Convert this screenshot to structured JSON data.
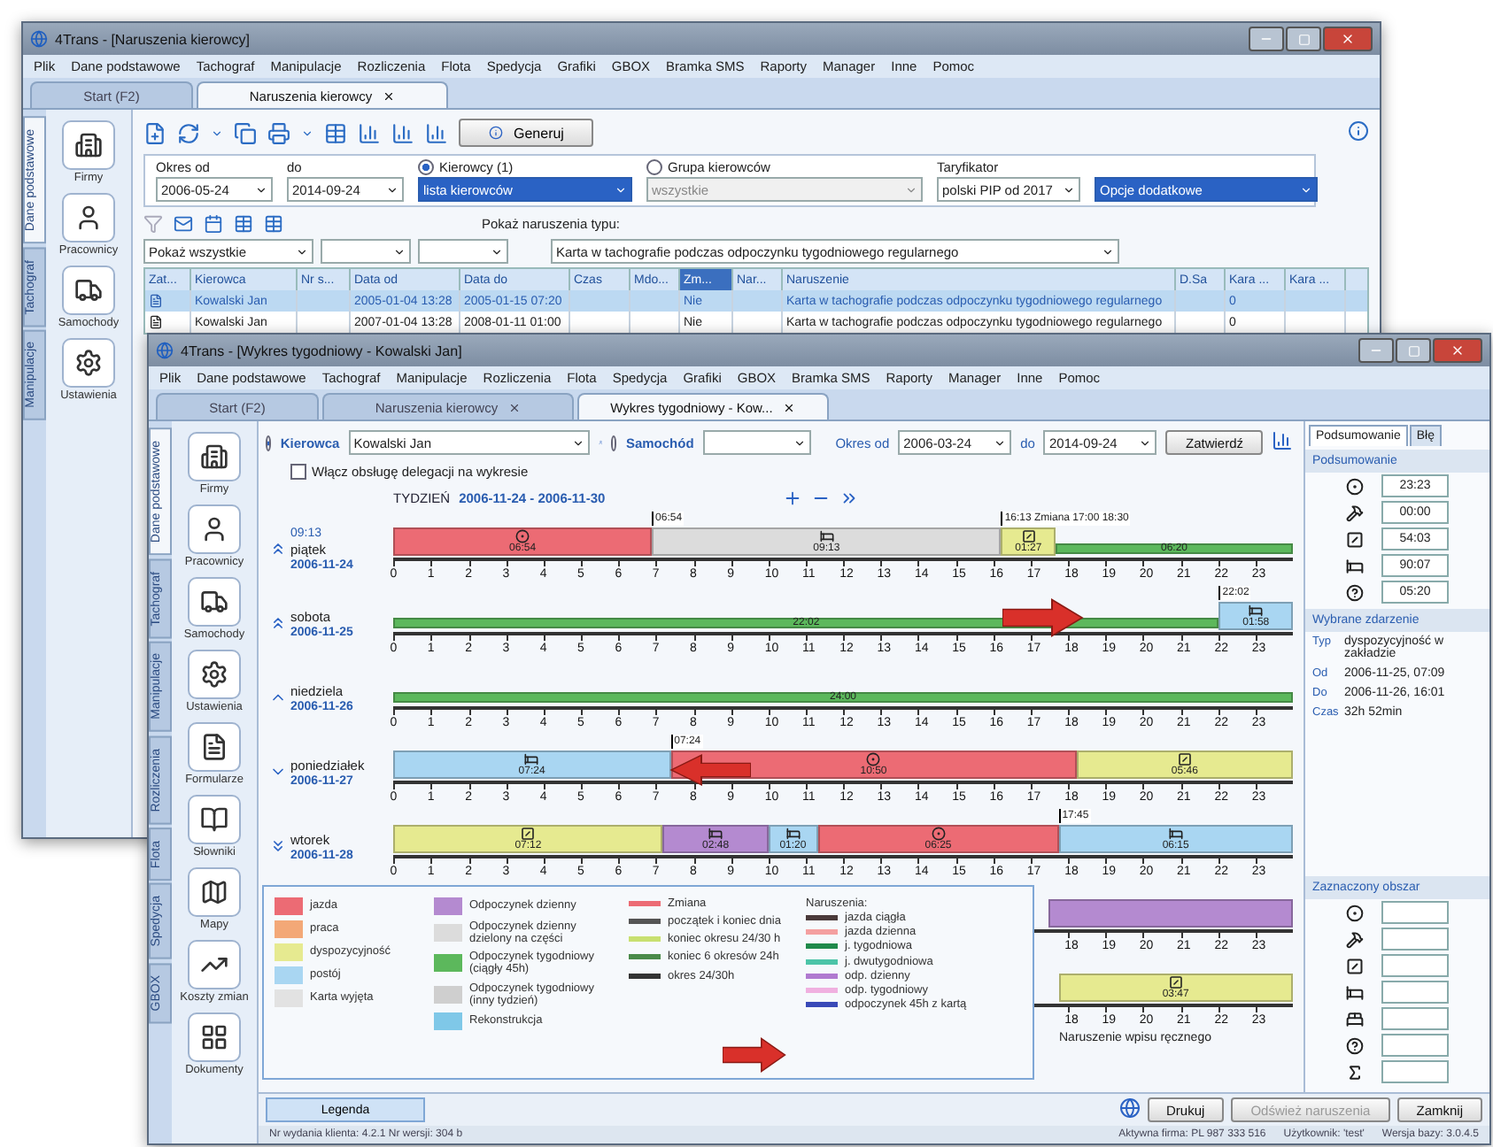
{
  "back_window": {
    "title": "4Trans - [Naruszenia kierowcy]",
    "menu": [
      "Plik",
      "Dane podstawowe",
      "Tachograf",
      "Manipulacje",
      "Rozliczenia",
      "Flota",
      "Spedycja",
      "Grafiki",
      "GBOX",
      "Bramka SMS",
      "Raporty",
      "Manager",
      "Inne",
      "Pomoc"
    ],
    "tabs": [
      {
        "label": "Start (F2)",
        "selected": false,
        "closable": false
      },
      {
        "label": "Naruszenia kierowcy",
        "selected": true,
        "closable": true
      }
    ],
    "side_tabs": [
      {
        "label": "Dane podstawowe",
        "selected": true
      },
      {
        "label": "Tachograf",
        "selected": false
      },
      {
        "label": "Manipulacje",
        "selected": false
      }
    ],
    "sidebar": [
      {
        "label": "Firmy"
      },
      {
        "label": "Pracownicy"
      },
      {
        "label": "Samochody"
      },
      {
        "label": "Ustawienia"
      }
    ],
    "generate": "Generuj",
    "filters": {
      "from_label": "Okres od",
      "from": "2006-05-24",
      "to_label": "do",
      "to": "2014-09-24",
      "drivers": {
        "label": "Kierowcy (1)",
        "selected": true,
        "value": "lista kierowców"
      },
      "group": {
        "label": "Grupa kierowców",
        "selected": false,
        "value": "wszystkie"
      },
      "tariff_label": "Taryfikator",
      "tariff": "polski PIP od 2017",
      "options": "Opcje dodatkowe"
    },
    "show_filter": "Pokaż wszystkie",
    "type_filter": {
      "label": "Pokaż naruszenia typu:",
      "value": "Karta w tachografie podczas odpoczynku tygodniowego regularnego"
    },
    "grid": {
      "columns": [
        {
          "label": "Zat...",
          "active": false
        },
        {
          "label": "Kierowca",
          "active": false
        },
        {
          "label": "Nr s...",
          "active": false
        },
        {
          "label": "Data od",
          "active": false
        },
        {
          "label": "Data do",
          "active": false
        },
        {
          "label": "Czas",
          "active": false
        },
        {
          "label": "Mdo...",
          "active": false
        },
        {
          "label": "Zm...",
          "active": true
        },
        {
          "label": "Nar...",
          "active": false
        },
        {
          "label": "Naruszenie",
          "active": false
        },
        {
          "label": "D.Sa",
          "active": false
        },
        {
          "label": "Kara ...",
          "active": false
        },
        {
          "label": "Kara ...",
          "active": false
        }
      ],
      "rows": [
        {
          "selected": true,
          "cells": [
            null,
            "Kowalski Jan",
            null,
            "2005-01-04 13:28",
            "2005-01-15 07:20",
            null,
            null,
            "Nie",
            null,
            "Karta w tachografie podczas odpoczynku tygodniowego regularnego",
            null,
            "0",
            null
          ]
        },
        {
          "selected": false,
          "cells": [
            null,
            "Kowalski Jan",
            null,
            "2007-01-04 13:28",
            "2008-01-11 01:00",
            null,
            null,
            "Nie",
            null,
            "Karta w tachografie podczas odpoczynku tygodniowego regularnego",
            null,
            "0",
            null
          ]
        }
      ]
    }
  },
  "front_window": {
    "title": "4Trans - [Wykres tygodniowy - Kowalski Jan]",
    "menu": [
      "Plik",
      "Dane podstawowe",
      "Tachograf",
      "Manipulacje",
      "Rozliczenia",
      "Flota",
      "Spedycja",
      "Grafiki",
      "GBOX",
      "Bramka SMS",
      "Raporty",
      "Manager",
      "Inne",
      "Pomoc"
    ],
    "tabs": [
      {
        "label": "Start (F2)",
        "selected": false,
        "closable": false
      },
      {
        "label": "Naruszenia kierowcy",
        "selected": false,
        "closable": true
      },
      {
        "label": "Wykres tygodniowy - Kow...",
        "selected": true,
        "closable": true
      }
    ],
    "side_tabs": [
      {
        "label": "Dane podstawowe",
        "selected": true
      },
      {
        "label": "Tachograf",
        "selected": false
      },
      {
        "label": "Manipulacje",
        "selected": false
      },
      {
        "label": "Rozliczenia",
        "selected": false
      },
      {
        "label": "Flota",
        "selected": false
      },
      {
        "label": "Spedycja",
        "selected": false
      },
      {
        "label": "GBOX",
        "selected": false
      }
    ],
    "sidebar": [
      {
        "label": "Firmy"
      },
      {
        "label": "Pracownicy"
      },
      {
        "label": "Samochody"
      },
      {
        "label": "Ustawienia"
      },
      {
        "label": "Formularze"
      },
      {
        "label": "Słowniki"
      },
      {
        "label": "Mapy"
      },
      {
        "label": "Koszty zmian"
      },
      {
        "label": "Dokumenty"
      }
    ],
    "controls": {
      "driver": {
        "label": "Kierowca",
        "selected": true,
        "value": "Kowalski Jan"
      },
      "vehicle": {
        "label": "Samochód",
        "selected": false
      },
      "from_label": "Okres od",
      "from": "2006-03-24",
      "to_label": "do",
      "to": "2014-09-24",
      "confirm": "Zatwierdź"
    },
    "delegation": {
      "label": "Włącz obsługę delegacji na wykresie",
      "checked": false
    },
    "week": {
      "label": "TYDZIEŃ",
      "range": "2006-11-24 - 2006-11-30"
    },
    "days": [
      {
        "note": "09:13",
        "day": "piątek",
        "date": "2006-11-24",
        "ticks": [
          "0",
          "1",
          "2",
          "3",
          "4",
          "5",
          "6",
          "7",
          "8",
          "9",
          "10",
          "11",
          "12",
          "13",
          "14",
          "15",
          "16",
          "17",
          "18",
          "19",
          "20",
          "21",
          "22",
          "23"
        ],
        "segments": [
          {
            "kind": "driving",
            "label": "06:54"
          },
          {
            "kind": "split_rest",
            "label": "09:13"
          },
          {
            "kind": "availability",
            "label": "01:27"
          },
          {
            "kind": "weekly_rest",
            "label": "06:20"
          }
        ],
        "markers": [
          "06:54",
          "16:13 Zmiana 17:00 18:30"
        ]
      },
      {
        "day": "sobota",
        "date": "2006-11-25",
        "ticks": [
          "0",
          "1",
          "2",
          "3",
          "4",
          "5",
          "6",
          "7",
          "8",
          "9",
          "10",
          "11",
          "12",
          "13",
          "14",
          "15",
          "16",
          "17",
          "18",
          "19",
          "20",
          "21",
          "22",
          "23"
        ],
        "segments": [
          {
            "kind": "weekly_rest",
            "label": "22:02"
          },
          {
            "kind": "break",
            "label": "01:58"
          }
        ],
        "markers": [
          "22:02"
        ]
      },
      {
        "day": "niedziela",
        "date": "2006-11-26",
        "ticks": [
          "0",
          "1",
          "2",
          "3",
          "4",
          "5",
          "6",
          "7",
          "8",
          "9",
          "10",
          "11",
          "12",
          "13",
          "14",
          "15",
          "16",
          "17",
          "18",
          "19",
          "20",
          "21",
          "22",
          "23"
        ],
        "segments": [
          {
            "kind": "weekly_rest",
            "label": "24:00"
          }
        ]
      },
      {
        "day": "poniedziałek",
        "date": "2006-11-27",
        "ticks": [
          "0",
          "1",
          "2",
          "3",
          "4",
          "5",
          "6",
          "7",
          "8",
          "9",
          "10",
          "11",
          "12",
          "13",
          "14",
          "15",
          "16",
          "17",
          "18",
          "19",
          "20",
          "21",
          "22",
          "23"
        ],
        "segments": [
          {
            "kind": "break",
            "label": "07:24"
          },
          {
            "kind": "driving",
            "label": "10:50"
          },
          {
            "kind": "availability",
            "label": "05:46"
          }
        ],
        "markers": [
          "07:24"
        ]
      },
      {
        "day": "wtorek",
        "date": "2006-11-28",
        "ticks": [
          "0",
          "1",
          "2",
          "3",
          "4",
          "5",
          "6",
          "7",
          "8",
          "9",
          "10",
          "11",
          "12",
          "13",
          "14",
          "15",
          "16",
          "17",
          "18",
          "19",
          "20",
          "21",
          "22",
          "23"
        ],
        "segments": [
          {
            "kind": "availability",
            "label": "07:12"
          },
          {
            "kind": "daily_rest",
            "label": "02:48"
          },
          {
            "kind": "break",
            "label": "01:20"
          },
          {
            "kind": "driving",
            "label": "06:25"
          },
          {
            "kind": "break",
            "label": "06:15"
          }
        ],
        "markers": [
          "17:45"
        ]
      },
      {
        "ticks": [
          "18",
          "19",
          "20",
          "21",
          "22",
          "23"
        ],
        "segments": [
          {
            "kind": "daily_rest"
          }
        ]
      },
      {
        "ticks": [
          "18",
          "19",
          "20",
          "21",
          "22",
          "23"
        ],
        "segments": [
          {
            "kind": "availability",
            "label": "03:47"
          }
        ]
      }
    ],
    "legend": {
      "columns": [
        [
          {
            "color": "#ec6b74",
            "label": "jazda"
          },
          {
            "color": "#f3a877",
            "label": "praca"
          },
          {
            "color": "#e6ea90",
            "label": "dyspozycyjność"
          },
          {
            "color": "#a9d6f2",
            "label": "postój"
          },
          {
            "color": "#e2e2e2",
            "label": "Karta wyjęta"
          }
        ],
        [
          {
            "color": "#b48ad0",
            "label": "Odpoczynek dzienny"
          },
          {
            "color": "#dcdcdc",
            "label": "Odpoczynek dzienny dzielony na części"
          },
          {
            "color": "#5cb85c",
            "label": "Odpoczynek tygodniowy (ciągły 45h)"
          },
          {
            "color": "#cfcfcf",
            "label": "Odpoczynek tygodniowy (inny tydzień)"
          },
          {
            "color": "#7fc8e8",
            "label": "Rekonstrukcja"
          }
        ],
        [
          {
            "color": "#ec6b74",
            "label": "Zmiana"
          },
          {
            "color": "#555555",
            "label": "początek i koniec dnia"
          },
          {
            "color": "#c8e070",
            "label": "koniec okresu 24/30 h"
          },
          {
            "color": "#4a8a4a",
            "label": "koniec 6 okresów 24h"
          },
          {
            "color": "#333333",
            "label": "okres 24/30h"
          }
        ]
      ],
      "violations_title": "Naruszenia:",
      "violations": [
        {
          "color": "#4a3a3a",
          "label": "jazda ciągła"
        },
        {
          "color": "#f4a0a0",
          "label": "jazda dzienna"
        },
        {
          "color": "#1f8a4a",
          "label": "j. tygodniowa"
        },
        {
          "color": "#4cc4a8",
          "label": "j. dwutygodniowa"
        },
        {
          "color": "#b07ad0",
          "label": "odp. dzienny"
        },
        {
          "color": "#f0b0e0",
          "label": "odp. tygodniowy"
        },
        {
          "color": "#3a4ab8",
          "label": "odpoczynek 45h z kartą"
        }
      ]
    },
    "footnote": "Naruszenie wpisu ręcznego",
    "summary": {
      "tabs": [
        {
          "label": "Podsumowanie",
          "selected": true
        },
        {
          "label": "Błę",
          "selected": false
        }
      ],
      "totals_title": "Podsumowanie",
      "totals": [
        {
          "kind": "driving",
          "value": "23:23"
        },
        {
          "kind": "work",
          "value": "00:00"
        },
        {
          "kind": "availability",
          "value": "54:03"
        },
        {
          "kind": "rest",
          "value": "90:07"
        },
        {
          "kind": "unknown",
          "value": "05:20"
        }
      ],
      "event_title": "Wybrane zdarzenie",
      "event": [
        {
          "label": "Typ",
          "value": "dyspozycyjność w zakładzie"
        },
        {
          "label": "Od",
          "value": "2006-11-25, 07:09"
        },
        {
          "label": "Do",
          "value": "2006-11-26, 16:01"
        },
        {
          "label": "Czas",
          "value": "32h 52min"
        }
      ],
      "selection_title": "Zaznaczony obszar",
      "selection": [
        {
          "kind": "driving"
        },
        {
          "kind": "work"
        },
        {
          "kind": "availability"
        },
        {
          "kind": "rest"
        },
        {
          "kind": "multi"
        },
        {
          "kind": "unknown"
        },
        {
          "kind": "sum"
        }
      ]
    },
    "legend_tab": "Legenda",
    "version": "Nr wydania klienta: 4.2.1   Nr wersji: 304 b",
    "buttons": [
      {
        "label": "Drukuj",
        "disabled": false
      },
      {
        "label": "Odśwież naruszenia",
        "disabled": true
      },
      {
        "label": "Zamknij",
        "disabled": false
      }
    ],
    "status": [
      "Aktywna firma: PL 987 333 516",
      "Użytkownik: 'test'",
      "Wersja bazy: 3.0.4.5"
    ]
  }
}
